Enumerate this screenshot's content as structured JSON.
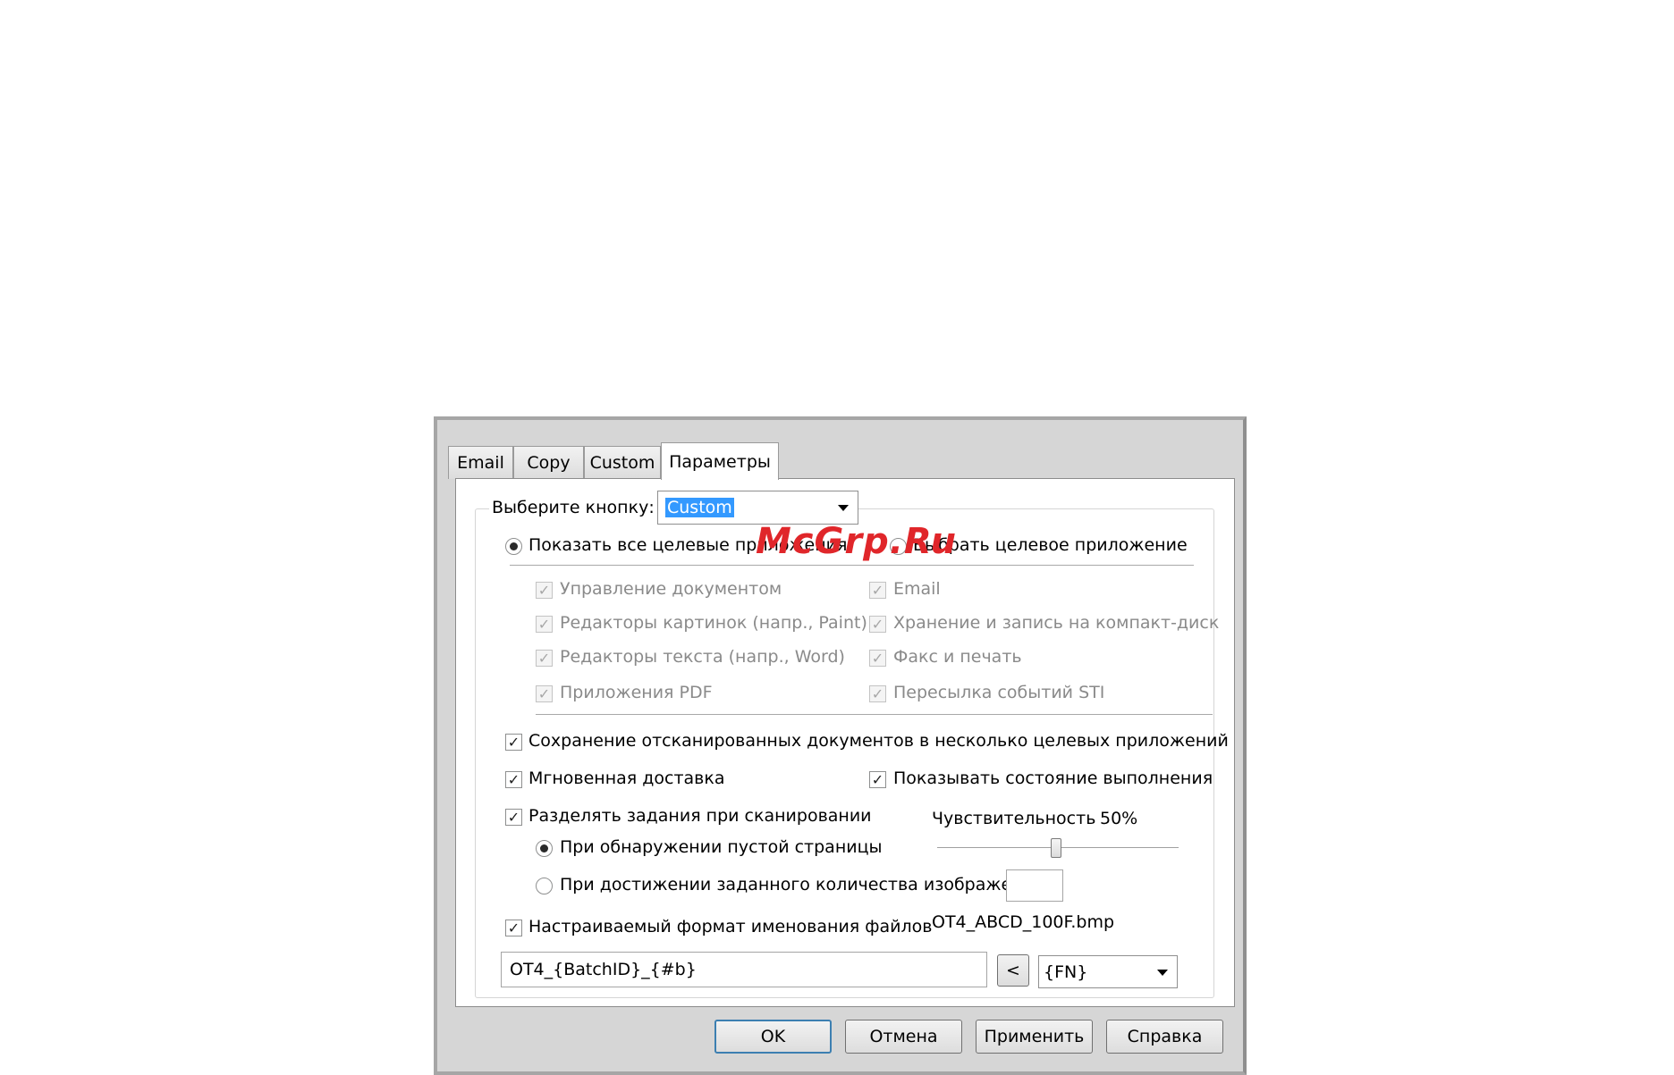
{
  "tabs": [
    "Email",
    "Copy",
    "Custom",
    "Параметры"
  ],
  "select_button": {
    "label": "Выберите кнопку:",
    "value": "Custom"
  },
  "radios": {
    "show_all": "Показать все целевые приложения",
    "choose_target": "Выбрать целевое приложение"
  },
  "app_checkboxes": {
    "left": [
      "Управление документом",
      "Редакторы картинок (напр., Paint)",
      "Редакторы текста (напр., Word)",
      "Приложения PDF"
    ],
    "right": [
      "Email",
      "Хранение и запись на компакт-диск",
      "Факс и печать",
      "Пересылка событий STI"
    ]
  },
  "options": {
    "save_multi": "Сохранение отсканированных документов в несколько целевых приложений",
    "instant_delivery": "Мгновенная доставка",
    "show_progress": "Показывать состояние выполнения",
    "split_jobs": "Разделять задания при сканировании",
    "sensitivity_label": "Чувствительность",
    "sensitivity_value": "50%",
    "sensitivity_level": 0.5,
    "on_blank_page": "При обнаружении пустой страницы",
    "on_image_count": "При достижении заданного количества изображений",
    "image_count_value": "",
    "custom_naming": "Настраиваемый формат именования файлов",
    "filename_preview": "OT4_ABCD_100F.bmp",
    "naming_format": "OT4_{BatchID}_{#b}",
    "insert_button": "<",
    "token_select": "{FN}"
  },
  "buttons": {
    "ok": "OK",
    "cancel": "Отмена",
    "apply": "Применить",
    "help": "Справка"
  },
  "watermark": "McGrp.Ru"
}
